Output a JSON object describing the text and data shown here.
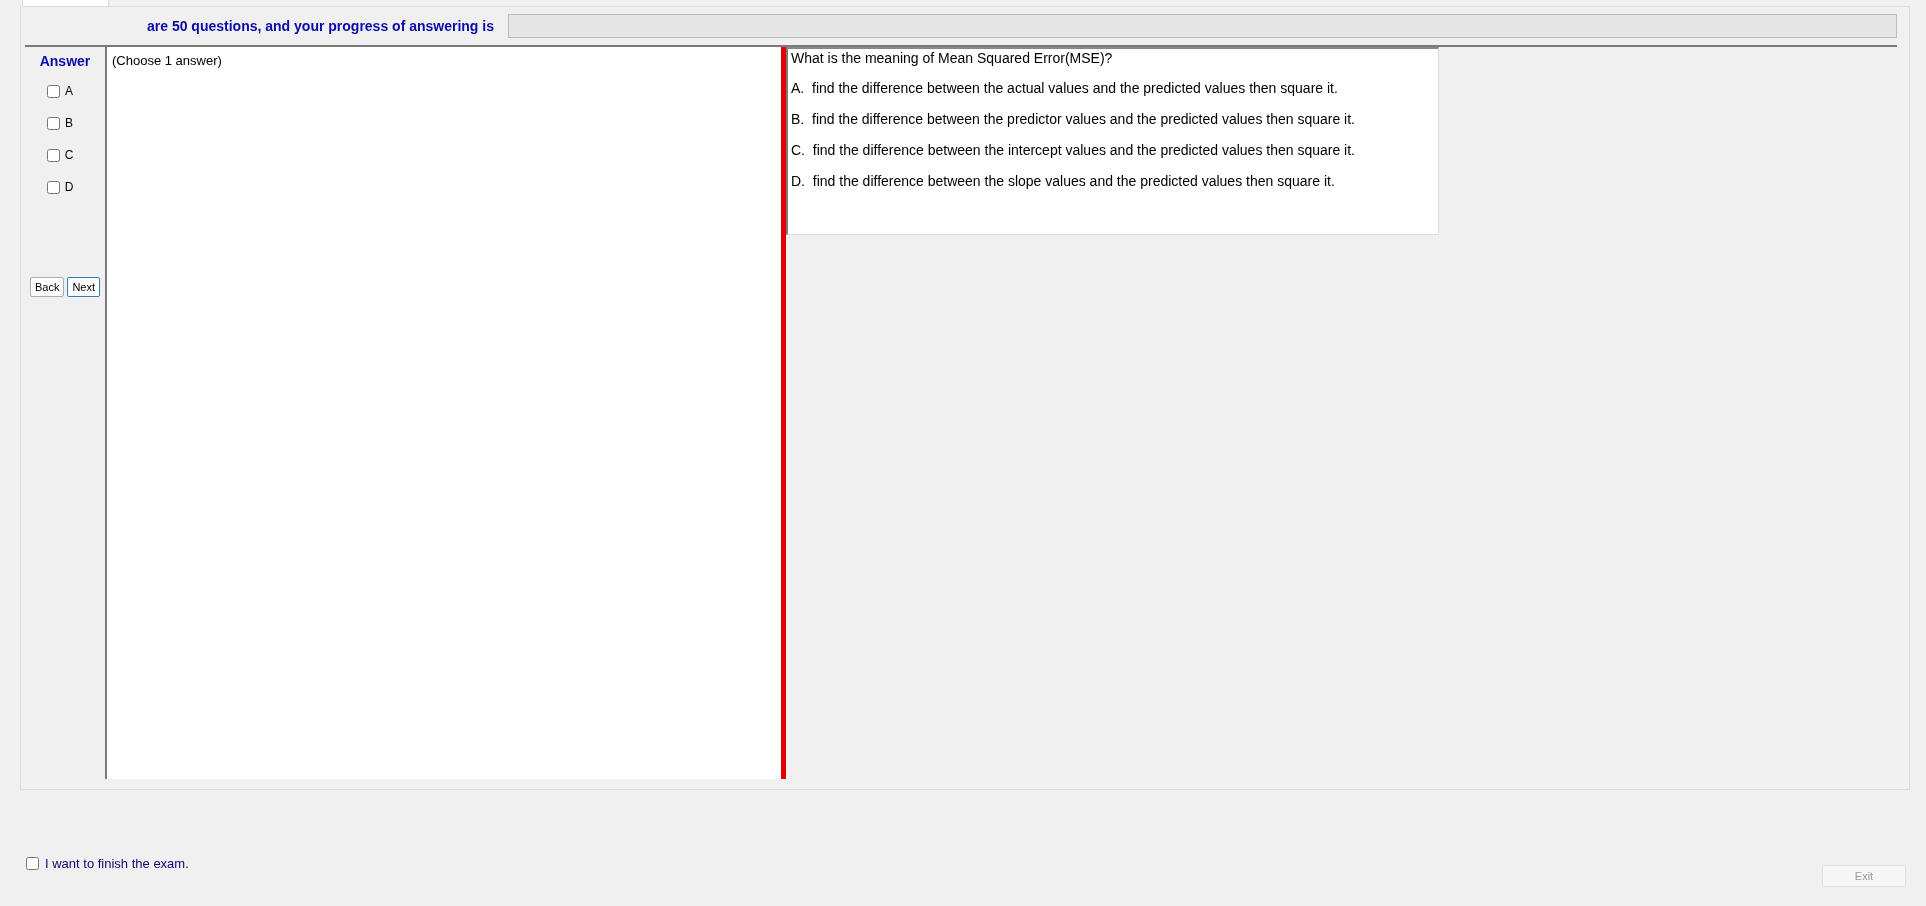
{
  "header": {
    "text": "are 50 questions, and your progress of answering is",
    "progress": {
      "level": 0
    }
  },
  "answer_panel": {
    "title": "Answer",
    "options": [
      {
        "label": "A",
        "checked": false
      },
      {
        "label": "B",
        "checked": false
      },
      {
        "label": "C",
        "checked": false
      },
      {
        "label": "D",
        "checked": false
      }
    ],
    "buttons": [
      {
        "label": "Back",
        "selected": false
      },
      {
        "label": "Next",
        "selected": true
      }
    ]
  },
  "instruction": "(Choose 1 answer)",
  "question": {
    "text": "What is the meaning of Mean Squared Error(MSE)?",
    "choices": [
      "A.  find the difference between the actual values and the predicted values then square it.",
      "B.  find the difference between the predictor values and the predicted values then square it.",
      "C.  find the difference between the intercept values and the predicted values then square it.",
      "D.  find the difference between the slope values and the predicted values then square it."
    ]
  },
  "finish": {
    "label": "I want to finish the exam.",
    "checked": false
  },
  "exit_button": {
    "label": "Exit",
    "disabled": true
  }
}
